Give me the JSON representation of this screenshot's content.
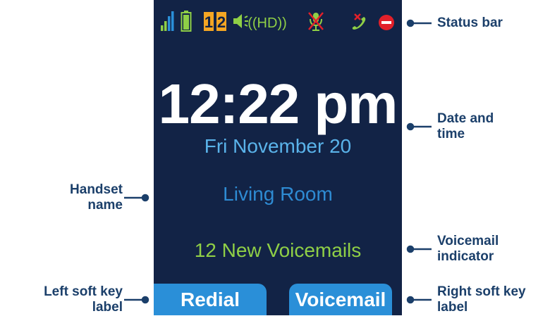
{
  "colors": {
    "screen_bg": "#122346",
    "clock": "#ffffff",
    "date": "#5ab3ea",
    "handset_name": "#2e8bd3",
    "voicemail_indicator": "#8fcf46",
    "softkey_bg": "#2a8fd8",
    "callout_text": "#1b3f6a"
  },
  "status_bar": {
    "icons": [
      "signal-strength-icon",
      "battery-icon",
      "line-1-icon",
      "line-2-icon",
      "speaker-icon",
      "hd-audio-icon",
      "mute-icon",
      "missed-call-icon",
      "do-not-disturb-icon"
    ],
    "line_1": "1",
    "line_2": "2",
    "hd_label": "((HD))"
  },
  "screen": {
    "time": "12:22 pm",
    "date": "Fri November 20",
    "handset_name": "Living Room",
    "voicemail_indicator": "12 New Voicemails",
    "left_softkey": "Redial",
    "right_softkey": "Voicemail"
  },
  "callouts": {
    "status_bar": "Status bar",
    "date_time_line1": "Date and",
    "date_time_line2": "time",
    "handset_line1": "Handset",
    "handset_line2": "name",
    "voicemail_line1": "Voicemail",
    "voicemail_line2": "indicator",
    "left_soft_key_line1": "Left soft key",
    "left_soft_key_line2": "label",
    "right_soft_key_line1": "Right soft key",
    "right_soft_key_line2": "label"
  }
}
